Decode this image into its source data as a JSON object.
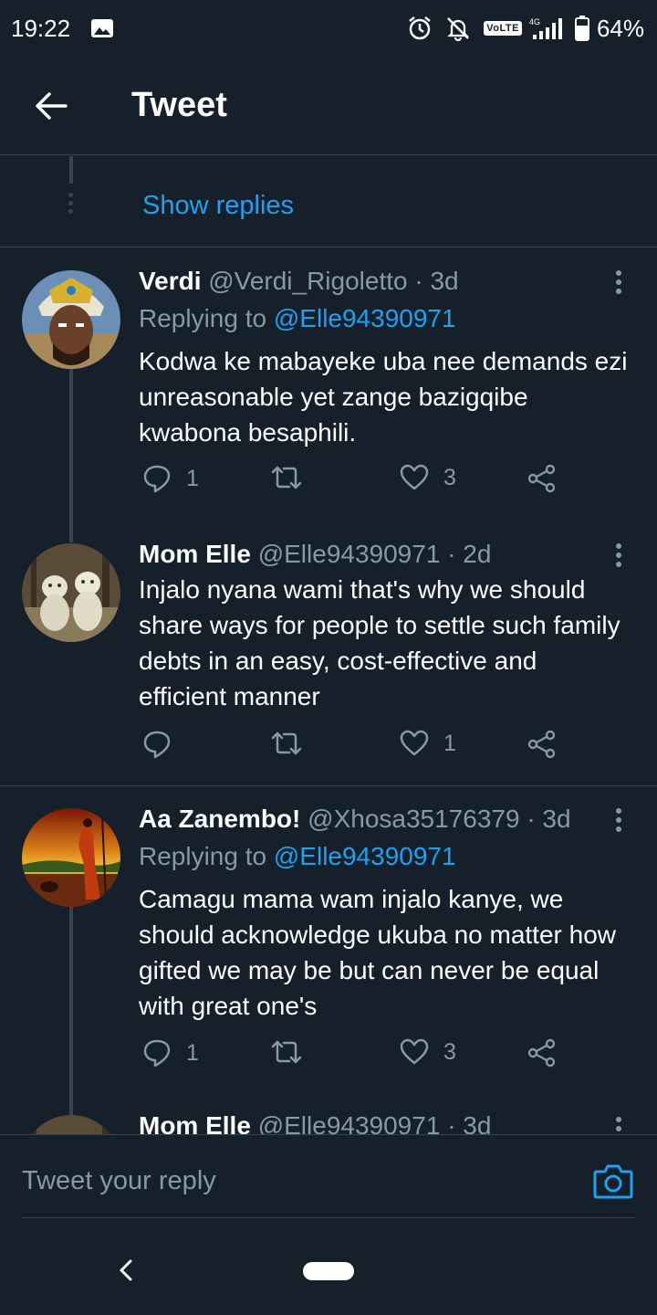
{
  "status": {
    "time": "19:22",
    "network": "VoLTE",
    "signal_label": "4G",
    "battery": "64%",
    "icons": [
      "image-icon",
      "alarm-icon",
      "notifications-off-icon",
      "signal-icon",
      "battery-icon"
    ]
  },
  "header": {
    "title": "Tweet",
    "back_icon": "arrow-left-icon"
  },
  "thread": {
    "show_replies": "Show replies"
  },
  "tweets": [
    {
      "name": "Verdi",
      "handle": "@Verdi_Rigoletto",
      "time": "· 3d",
      "replying_prefix": "Replying to",
      "replying_to": "@Elle94390971",
      "text": "Kodwa ke mabayeke uba nee demands ezi unreasonable yet zange bazigqibe kwabona besaphili.",
      "replies": "1",
      "retweets": "",
      "likes": "3"
    },
    {
      "name": "Mom Elle",
      "handle": "@Elle94390971",
      "time": "· 2d",
      "replying_prefix": "",
      "replying_to": "",
      "text": "Injalo nyana wami that's why we should share ways for people to settle such family debts in an easy, cost-effective and efficient manner",
      "replies": "",
      "retweets": "",
      "likes": "1"
    },
    {
      "name": "Aa Zanembo!",
      "handle": "@Xhosa35176379",
      "time": "· 3d",
      "replying_prefix": "Replying to",
      "replying_to": "@Elle94390971",
      "text": "Camagu mama wam injalo kanye, we should acknowledge ukuba no matter how gifted we may be but can never be equal with great one's",
      "replies": "1",
      "retweets": "",
      "likes": "3"
    },
    {
      "name": "Mom Elle",
      "handle": "@Elle94390971",
      "time": "· 3d"
    }
  ],
  "composer": {
    "placeholder": "Tweet your reply",
    "camera_icon": "camera-icon"
  },
  "colors": {
    "background": "#15202b",
    "accent": "#1da1f2",
    "muted": "#8899a6",
    "divider": "#38444d"
  }
}
